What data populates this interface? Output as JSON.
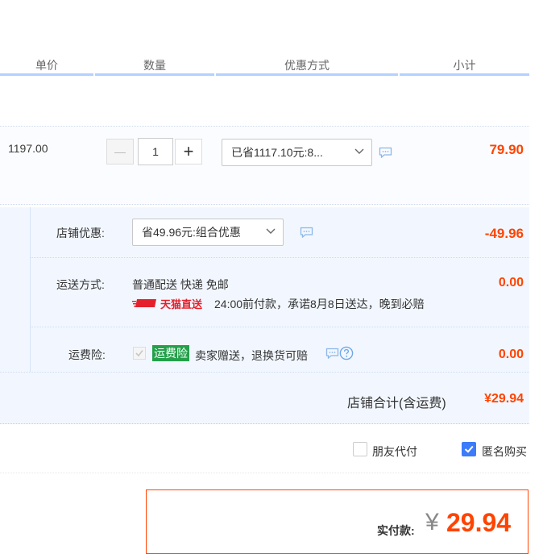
{
  "columns": {
    "unit_price": "单价",
    "quantity": "数量",
    "discount": "优惠方式",
    "subtotal": "小计"
  },
  "item": {
    "unit_price": "1197.00",
    "quantity": "1",
    "minus_symbol": "—",
    "plus_symbol": "+",
    "discount_select": "已省1117.10元:8...",
    "subtotal": "79.90"
  },
  "shop": {
    "discount_label": "店铺优惠:",
    "discount_select": "省49.96元:组合优惠",
    "discount_value": "-49.96",
    "shipping_label": "运送方式:",
    "shipping_method": "普通配送 快递 免邮",
    "tmall_badge": "天猫直送",
    "delivery_promise": "24:00前付款，承诺8月8日送达，晚到必赔",
    "shipping_value": "0.00",
    "insurance_label": "运费险:",
    "insurance_tag": "运费险",
    "insurance_desc": "卖家赠送，退换货可赔",
    "insurance_value": "0.00",
    "total_label": "店铺合计(含运费)",
    "total_value": "¥29.94"
  },
  "options": {
    "friend_pay": "朋友代付",
    "friend_pay_checked": false,
    "anonymous": "匿名购买",
    "anonymous_checked": true
  },
  "payment": {
    "label": "实付款:",
    "currency": "¥",
    "amount": "29.94"
  },
  "colors": {
    "accent_red": "#ff4400",
    "header_line": "#b2d1ff",
    "checkbox_blue": "#3c7bfa",
    "insurance_green": "#23a04a"
  },
  "icons": [
    "chat-icon",
    "help-icon",
    "chevron-down-icon",
    "check-icon",
    "tmall-delivery-icon"
  ]
}
